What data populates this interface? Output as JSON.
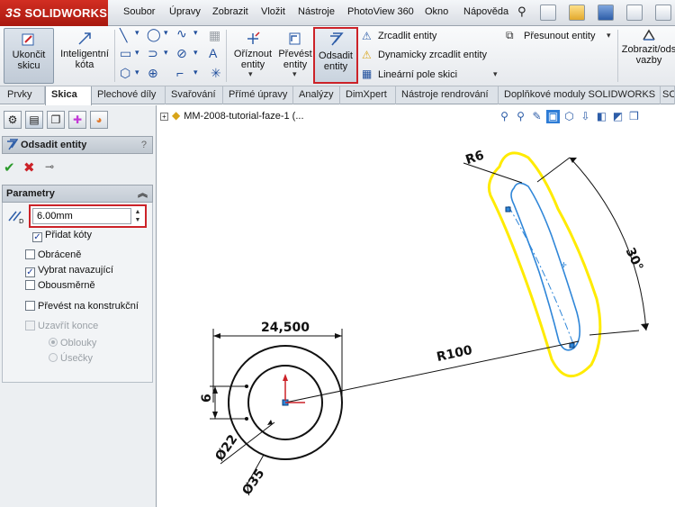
{
  "app": {
    "logo_prefix": "3S",
    "logo_text": "SOLIDWORKS"
  },
  "menu": [
    "Soubor",
    "Úpravy",
    "Zobrazit",
    "Vložit",
    "Nástroje",
    "PhotoView 360",
    "Okno",
    "Nápověda"
  ],
  "ribbon": {
    "exit_sketch": "Ukončit\nskicu",
    "smart_dim": "Inteligentní\nkóta",
    "trim": "Oříznout\nentity",
    "convert": "Převést\nentity",
    "offset": "Odsadit\nentity",
    "mirror": "Zrcadlit entity",
    "dyn_mirror": "Dynamicky zrcadlit entity",
    "linear_pattern": "Lineární pole skici",
    "move": "Přesunout entity",
    "display_relations": "Zobrazit/ods\nvazby"
  },
  "tabs": [
    "Prvky",
    "Skica",
    "Plechové díly",
    "Svařování",
    "Přímé úpravy",
    "Analýzy",
    "DimXpert",
    "Nástroje rendrování",
    "Doplňkové moduly SOLIDWORKS",
    "SC"
  ],
  "active_tab": "Skica",
  "property_manager": {
    "title": "Odsadit entity",
    "help": "?",
    "group_title": "Parametry",
    "distance_value": "6.00mm",
    "add_dims": "Přidat kóty",
    "reverse": "Obráceně",
    "select_chain": "Vybrat navazující",
    "bidirectional": "Obousměrně",
    "make_construction": "Převést na konstrukční",
    "cap_ends": "Uzavřít konce",
    "arcs": "Oblouky",
    "lines": "Úsečky",
    "checked": {
      "add_dims": true,
      "reverse": false,
      "select_chain": true,
      "bidirectional": false,
      "make_construction": false,
      "cap_ends": false
    },
    "selected_cap": "arcs"
  },
  "graphics": {
    "feature_tree_item": "MM-2008-tutorial-faze-1  (..."
  },
  "dimensions": {
    "d1": "24,500",
    "d2": "6",
    "d3": "Ø22",
    "d4": "Ø35",
    "d5": "R100",
    "d6": "R6",
    "d7": "30°"
  },
  "colors": {
    "highlight": "#cc2228",
    "selection": "#ffeb00",
    "sketch": "#2f86d8",
    "sketch_dark": "#111111"
  }
}
